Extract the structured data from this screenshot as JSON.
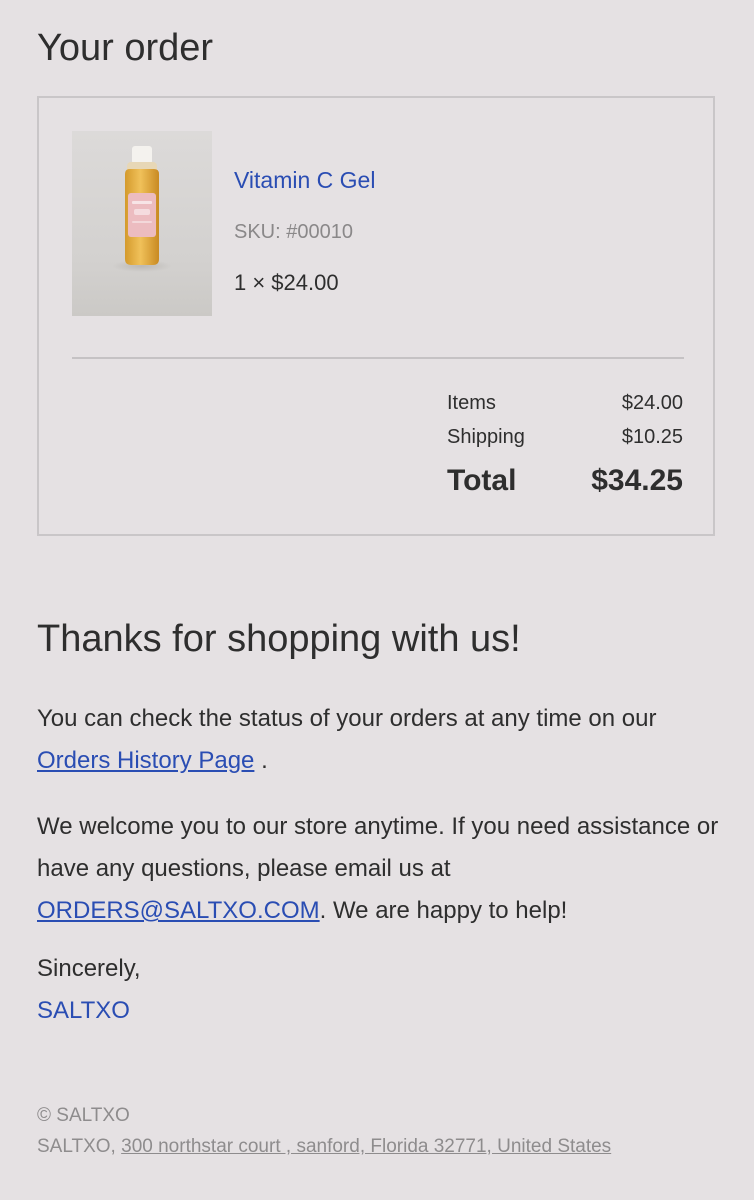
{
  "order": {
    "title": "Your order",
    "item": {
      "name": "Vitamin C Gel",
      "sku": "SKU: #00010",
      "quantity_price": "1 × $24.00",
      "thumbnail": "vitamin-c-gel-bottle-photo"
    },
    "summary": {
      "items_label": "Items",
      "items_value": "$24.00",
      "shipping_label": "Shipping",
      "shipping_value": "$10.25",
      "total_label": "Total",
      "total_value": "$34.25"
    }
  },
  "thanks": {
    "title": "Thanks for shopping with us!",
    "status_prefix": "You can check the status of your orders at any time on our ",
    "status_link": "Orders History Page",
    "status_suffix": " .",
    "welcome_prefix": "We welcome you to our store anytime. If you need assistance or have any questions, please email us at ",
    "email_link": "ORDERS@SALTXO.COM",
    "welcome_suffix": ". We are happy to help!",
    "sign_off": "Sincerely,",
    "signature": "SALTXO"
  },
  "footer": {
    "copyright": "© SALTXO",
    "company": "SALTXO, ",
    "address": "300 northstar court , sanford, Florida 32771, United States"
  },
  "colors": {
    "background": "#e5e1e3",
    "link": "#2a4db3",
    "text": "#2e2e2e",
    "muted": "#8a8889"
  }
}
